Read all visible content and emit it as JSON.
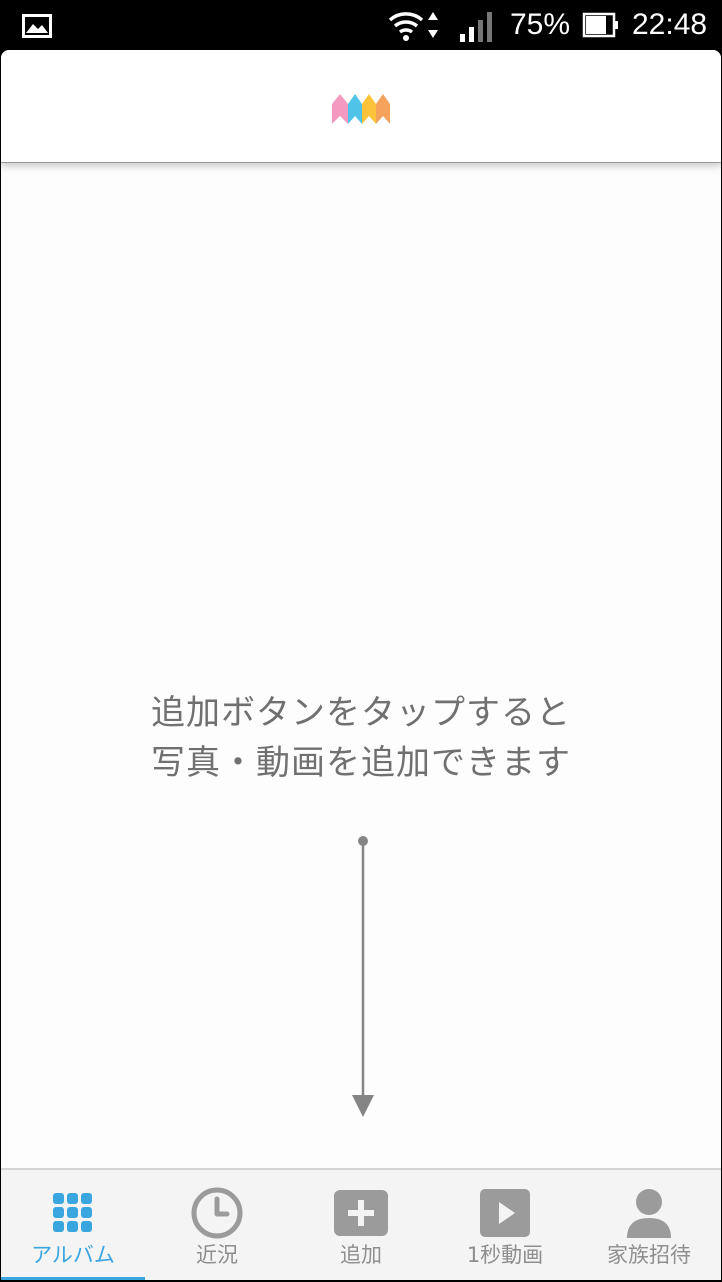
{
  "status_bar": {
    "notification_icon": "gallery-icon",
    "battery_percent": "75%",
    "time": "22:48"
  },
  "app_bar": {
    "logo_icon": "m-logo-icon",
    "logo_colors": [
      "#f49ac1",
      "#4fc3e8",
      "#fcc33a",
      "#f5a25d"
    ]
  },
  "empty_state": {
    "line1": "追加ボタンをタップすると",
    "line2": "写真・動画を追加できます"
  },
  "bottom_nav": {
    "accent": "#3aa6e0",
    "items": [
      {
        "label": "アルバム",
        "icon": "grid-icon",
        "active": true
      },
      {
        "label": "近況",
        "icon": "clock-icon",
        "active": false
      },
      {
        "label": "追加",
        "icon": "plus-icon",
        "active": false
      },
      {
        "label": "1秒動画",
        "icon": "play-icon",
        "active": false
      },
      {
        "label": "家族招待",
        "icon": "person-icon",
        "active": false
      }
    ]
  }
}
